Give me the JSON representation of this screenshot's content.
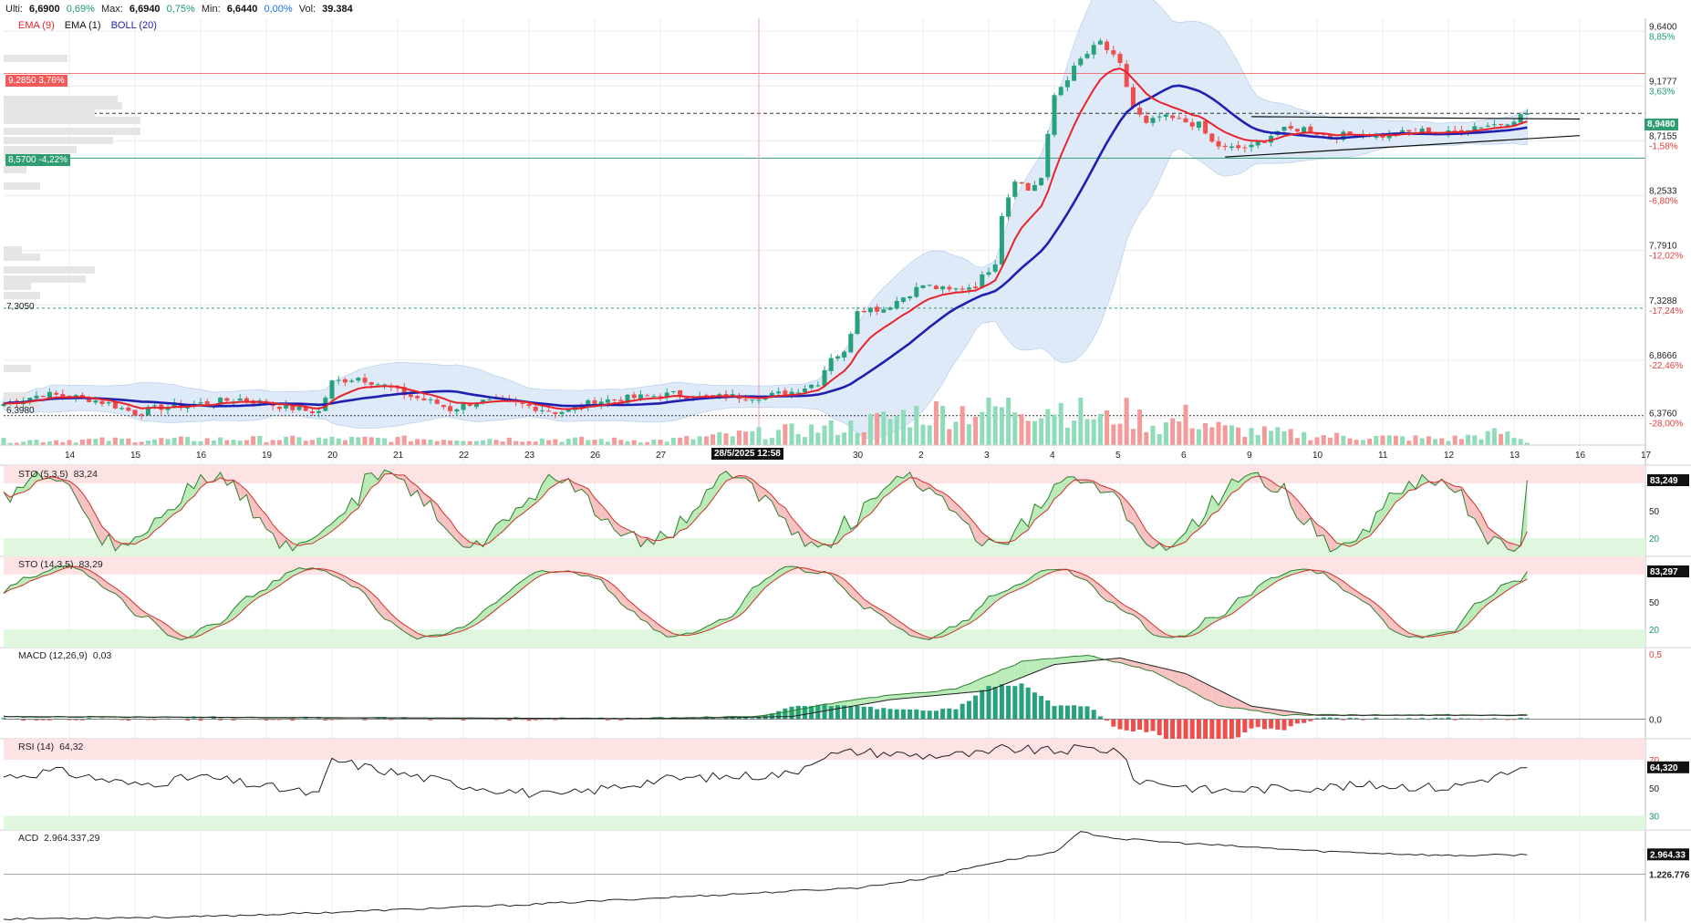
{
  "header": {
    "last_label": "Ulti:",
    "last_value": "6,6900",
    "last_change": "0,69%",
    "max_label": "Max:",
    "max_value": "6,6940",
    "max_change": "0,75%",
    "min_label": "Min:",
    "min_value": "6,6440",
    "min_change": "0,00%",
    "vol_label": "Vol:",
    "vol_value": "39.384"
  },
  "legend": {
    "ema9": "EMA (9)",
    "ema1": "EMA (1)",
    "boll": "BOLL (20)",
    "ema9_color": "#e8242b",
    "ema1_color": "#111111",
    "boll_color": "#1f1fb0"
  },
  "colors": {
    "up": "#26a17b",
    "down": "#ef4c4c",
    "vol_up": "#8fdcb9",
    "vol_down": "#f49a9a",
    "band_fill": "#dbe8f8",
    "grid": "#ececec"
  },
  "price_tags": {
    "resistance_label": "9,2850  3,76%",
    "support_label": "8,5700  -4,22%",
    "left_level_1": "7,3050",
    "left_level_2": "6,3980",
    "current_price": "8,9480",
    "crosshair_label": "28/5/2025 12:58"
  },
  "chart_data": [
    {
      "type": "candlestick",
      "title": "",
      "y_axis": {
        "range": [
          6.15,
          9.75
        ],
        "ticks": [
          {
            "value": 9.64,
            "label": "9,6400",
            "pct": "8,85%"
          },
          {
            "value": 9.1777,
            "label": "9,1777",
            "pct": "3,63%"
          },
          {
            "value": 8.7155,
            "label": "8,7155",
            "pct": "-1,58%"
          },
          {
            "value": 8.2533,
            "label": "8,2533",
            "pct": "-6,80%"
          },
          {
            "value": 7.791,
            "label": "7,7910",
            "pct": "-12,02%"
          },
          {
            "value": 7.3288,
            "label": "7,3288",
            "pct": "-17,24%"
          },
          {
            "value": 6.8666,
            "label": "6,8666",
            "pct": "-22,46%"
          },
          {
            "value": 6.376,
            "label": "6,3760",
            "pct": "-28,00%"
          }
        ]
      },
      "x_axis": {
        "range": [
          0,
          250
        ],
        "ticks": [
          {
            "value": 10,
            "label": "14"
          },
          {
            "value": 20,
            "label": "15"
          },
          {
            "value": 30,
            "label": "16"
          },
          {
            "value": 40,
            "label": "19"
          },
          {
            "value": 50,
            "label": "20"
          },
          {
            "value": 60,
            "label": "21"
          },
          {
            "value": 70,
            "label": "22"
          },
          {
            "value": 80,
            "label": "23"
          },
          {
            "value": 90,
            "label": "26"
          },
          {
            "value": 100,
            "label": "27"
          },
          {
            "value": 130,
            "label": "30"
          },
          {
            "value": 140,
            "label": "2"
          },
          {
            "value": 150,
            "label": "3"
          },
          {
            "value": 160,
            "label": "4"
          },
          {
            "value": 170,
            "label": "5"
          },
          {
            "value": 180,
            "label": "6"
          },
          {
            "value": 190,
            "label": "9"
          },
          {
            "value": 200,
            "label": "10"
          },
          {
            "value": 210,
            "label": "11"
          },
          {
            "value": 220,
            "label": "12"
          },
          {
            "value": 230,
            "label": "13"
          },
          {
            "value": 240,
            "label": "16"
          },
          {
            "value": 250,
            "label": "17"
          }
        ]
      },
      "levels": {
        "resistance": 9.285,
        "support": 8.57,
        "current": 8.948,
        "left_1": 7.305,
        "left_2": 6.398
      },
      "close_keypoints": [
        [
          0,
          6.5
        ],
        [
          6,
          6.58
        ],
        [
          12,
          6.55
        ],
        [
          16,
          6.5
        ],
        [
          20,
          6.42
        ],
        [
          24,
          6.47
        ],
        [
          30,
          6.5
        ],
        [
          36,
          6.54
        ],
        [
          40,
          6.5
        ],
        [
          46,
          6.44
        ],
        [
          48,
          6.43
        ],
        [
          50,
          6.68
        ],
        [
          54,
          6.72
        ],
        [
          58,
          6.65
        ],
        [
          62,
          6.56
        ],
        [
          66,
          6.5
        ],
        [
          68,
          6.45
        ],
        [
          72,
          6.52
        ],
        [
          78,
          6.5
        ],
        [
          84,
          6.43
        ],
        [
          86,
          6.44
        ],
        [
          90,
          6.52
        ],
        [
          96,
          6.55
        ],
        [
          102,
          6.58
        ],
        [
          106,
          6.55
        ],
        [
          110,
          6.56
        ],
        [
          116,
          6.56
        ],
        [
          120,
          6.6
        ],
        [
          124,
          6.68
        ],
        [
          126,
          6.9
        ],
        [
          128,
          6.92
        ],
        [
          130,
          7.3
        ],
        [
          134,
          7.3
        ],
        [
          140,
          7.5
        ],
        [
          144,
          7.45
        ],
        [
          148,
          7.5
        ],
        [
          151,
          7.7
        ],
        [
          152,
          8.1
        ],
        [
          154,
          8.4
        ],
        [
          156,
          8.3
        ],
        [
          158,
          8.4
        ],
        [
          160,
          9.1
        ],
        [
          164,
          9.4
        ],
        [
          167,
          9.55
        ],
        [
          170,
          9.35
        ],
        [
          172,
          9.0
        ],
        [
          174,
          8.85
        ],
        [
          176,
          8.92
        ],
        [
          178,
          8.9
        ],
        [
          182,
          8.85
        ],
        [
          184,
          8.7
        ],
        [
          186,
          8.65
        ],
        [
          190,
          8.66
        ],
        [
          194,
          8.8
        ],
        [
          198,
          8.82
        ],
        [
          202,
          8.75
        ],
        [
          206,
          8.78
        ],
        [
          210,
          8.76
        ],
        [
          216,
          8.8
        ],
        [
          220,
          8.78
        ],
        [
          224,
          8.84
        ],
        [
          228,
          8.86
        ],
        [
          232,
          8.948
        ]
      ],
      "volume_keypoints": [
        [
          0,
          0.15
        ],
        [
          40,
          0.2
        ],
        [
          80,
          0.2
        ],
        [
          100,
          0.15
        ],
        [
          129,
          0.6
        ],
        [
          138,
          1.0
        ],
        [
          152,
          1.2
        ],
        [
          156,
          1.3
        ],
        [
          160,
          1.3
        ],
        [
          168,
          0.8
        ],
        [
          170,
          1.1
        ],
        [
          176,
          0.6
        ],
        [
          180,
          0.9
        ],
        [
          186,
          0.5
        ],
        [
          200,
          0.3
        ],
        [
          220,
          0.2
        ],
        [
          228,
          0.4
        ],
        [
          232,
          0.1
        ]
      ]
    },
    {
      "type": "line",
      "name": "STO (5,3,5)",
      "value": "83,24",
      "last_label": "83,249",
      "y_axis": {
        "range": [
          0,
          100
        ],
        "ticks": [
          {
            "value": 50,
            "label": "50"
          },
          {
            "value": 20,
            "label": "20"
          }
        ]
      },
      "zones": {
        "upper": 80,
        "lower": 20
      }
    },
    {
      "type": "line",
      "name": "STO (14,3,5)",
      "value": "83,29",
      "last_label": "83,297",
      "y_axis": {
        "range": [
          0,
          100
        ],
        "ticks": [
          {
            "value": 50,
            "label": "50"
          },
          {
            "value": 20,
            "label": "20"
          }
        ]
      },
      "zones": {
        "upper": 80,
        "lower": 20
      }
    },
    {
      "type": "line",
      "name": "MACD (12,26,9)",
      "value": "0,03",
      "y_axis": {
        "range": [
          -0.15,
          0.55
        ],
        "ticks": [
          {
            "value": 0.5,
            "label": "0,5"
          },
          {
            "value": 0.0,
            "label": "0,0"
          }
        ]
      },
      "signal_keypoints": [
        [
          0,
          0.02
        ],
        [
          60,
          0.01
        ],
        [
          100,
          0.005
        ],
        [
          120,
          0.02
        ],
        [
          135,
          0.15
        ],
        [
          150,
          0.22
        ],
        [
          160,
          0.42
        ],
        [
          170,
          0.47
        ],
        [
          180,
          0.35
        ],
        [
          190,
          0.1
        ],
        [
          200,
          0.03
        ],
        [
          232,
          0.03
        ]
      ]
    },
    {
      "type": "line",
      "name": "RSI (14)",
      "value": "64,32",
      "last_label": "64,320",
      "y_axis": {
        "range": [
          20,
          85
        ],
        "ticks": [
          {
            "value": 70,
            "label": "70"
          },
          {
            "value": 50,
            "label": "50"
          },
          {
            "value": 30,
            "label": "30"
          }
        ]
      },
      "zones": {
        "upper": 70,
        "lower": 30
      },
      "keypoints": [
        [
          0,
          58
        ],
        [
          8,
          62
        ],
        [
          20,
          52
        ],
        [
          30,
          58
        ],
        [
          48,
          45
        ],
        [
          50,
          70
        ],
        [
          56,
          64
        ],
        [
          70,
          52
        ],
        [
          84,
          44
        ],
        [
          100,
          56
        ],
        [
          120,
          60
        ],
        [
          124,
          72
        ],
        [
          130,
          76
        ],
        [
          140,
          73
        ],
        [
          150,
          74
        ],
        [
          152,
          78
        ],
        [
          160,
          76
        ],
        [
          164,
          78
        ],
        [
          170,
          77
        ],
        [
          172,
          56
        ],
        [
          176,
          54
        ],
        [
          184,
          48
        ],
        [
          196,
          50
        ],
        [
          210,
          52
        ],
        [
          220,
          50
        ],
        [
          232,
          64
        ]
      ]
    },
    {
      "type": "line",
      "name": "ACD",
      "value": "2.964.337,29",
      "last_label": "2.964.33",
      "y_axis": {
        "range": [
          -3000000,
          5200000
        ],
        "ticks": [
          {
            "value": 1226776,
            "label": "1.226.776"
          }
        ]
      },
      "keypoints": [
        [
          0,
          -2800000
        ],
        [
          30,
          -2600000
        ],
        [
          50,
          -2200000
        ],
        [
          80,
          -1500000
        ],
        [
          110,
          -600000
        ],
        [
          130,
          0
        ],
        [
          140,
          800000
        ],
        [
          150,
          2200000
        ],
        [
          160,
          3200000
        ],
        [
          164,
          5000000
        ],
        [
          170,
          4400000
        ],
        [
          180,
          4000000
        ],
        [
          200,
          3300000
        ],
        [
          220,
          2900000
        ],
        [
          232,
          2964337
        ]
      ]
    }
  ]
}
